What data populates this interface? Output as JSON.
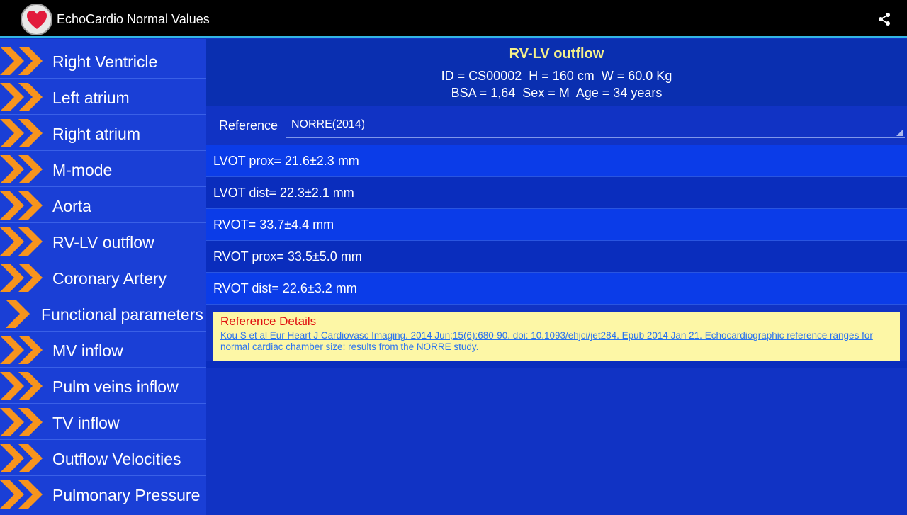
{
  "app": {
    "title": "EchoCardio Normal Values",
    "icon": "heart-icon",
    "share_icon": "share-icon"
  },
  "sidebar": {
    "items": [
      {
        "label": "Right Ventricle",
        "icon": "double-chevron-icon"
      },
      {
        "label": "Left atrium",
        "icon": "double-chevron-icon"
      },
      {
        "label": "Right atrium",
        "icon": "double-chevron-icon"
      },
      {
        "label": "M-mode",
        "icon": "double-chevron-icon"
      },
      {
        "label": "Aorta",
        "icon": "double-chevron-icon"
      },
      {
        "label": "RV-LV outflow",
        "icon": "double-chevron-icon"
      },
      {
        "label": "Coronary Artery",
        "icon": "double-chevron-icon"
      },
      {
        "label": "Functional parameters",
        "icon": "single-chevron-icon"
      },
      {
        "label": "MV inflow",
        "icon": "double-chevron-icon"
      },
      {
        "label": "Pulm veins inflow",
        "icon": "double-chevron-icon"
      },
      {
        "label": "TV inflow",
        "icon": "double-chevron-icon"
      },
      {
        "label": "Outflow Velocities",
        "icon": "double-chevron-icon"
      },
      {
        "label": "Pulmonary Pressure",
        "icon": "double-chevron-icon"
      }
    ]
  },
  "main": {
    "title": "RV-LV outflow",
    "patient_line1": "ID = CS00002  H = 160 cm  W = 60.0 Kg",
    "patient_line2": "BSA = 1,64  Sex = M  Age = 34 years",
    "reference_label": "Reference",
    "reference_value": "NORRE(2014)",
    "measurements": [
      "LVOT prox= 21.6±2.3 mm",
      "LVOT dist= 22.3±2.1 mm",
      "RVOT= 33.7±4.4 mm",
      "RVOT prox= 33.5±5.0 mm",
      "RVOT dist= 22.6±3.2 mm"
    ],
    "reference_details_title": "Reference Details",
    "reference_details_text": "Kou S et al Eur Heart J Cardiovasc Imaging. 2014 Jun;15(6):680-90. doi: 10.1093/ehjci/jet284. Epub 2014 Jan 21. Echocardiographic reference ranges for normal cardiac chamber size: results from the NORRE study."
  },
  "colors": {
    "accent": "#33b5e5",
    "chevron": "#f7941d",
    "title_yellow": "#f5f08a",
    "details_bg": "#fdf7a6",
    "details_title": "#e01010"
  }
}
